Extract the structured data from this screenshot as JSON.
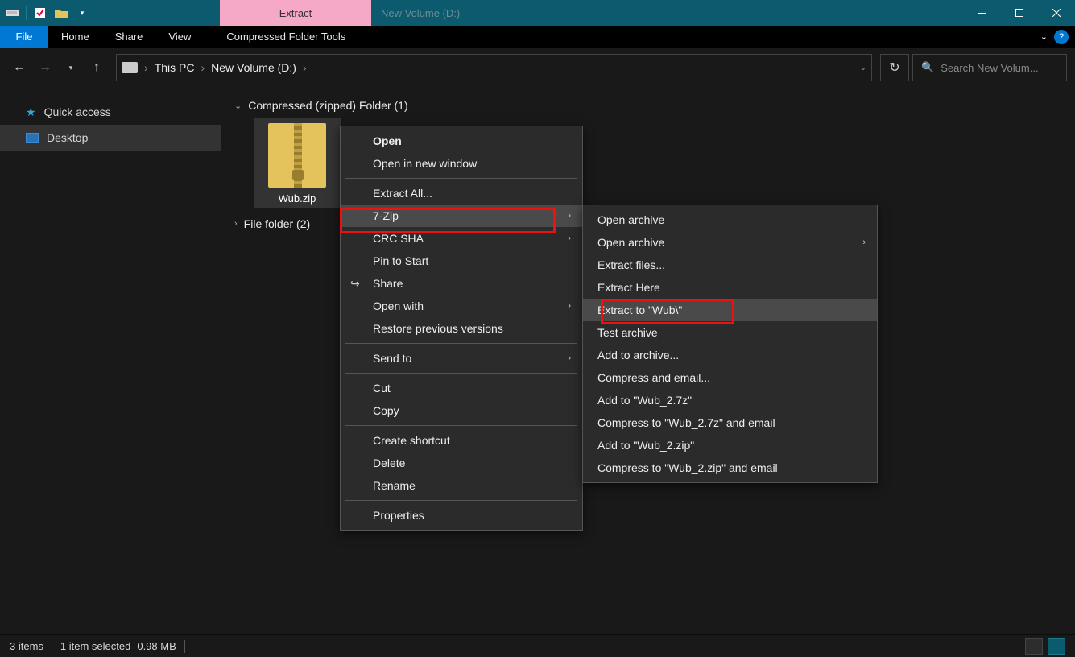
{
  "titlebar": {
    "contextual_tab": "Extract",
    "title": "New Volume (D:)"
  },
  "ribbon": {
    "file": "File",
    "tabs": [
      "Home",
      "Share",
      "View"
    ],
    "contextual": "Compressed Folder Tools"
  },
  "breadcrumb": {
    "root": "This PC",
    "path": "New Volume (D:)"
  },
  "search": {
    "placeholder": "Search New Volum..."
  },
  "sidebar": {
    "quick_access": "Quick access",
    "desktop": "Desktop"
  },
  "groups": {
    "zipped": "Compressed (zipped) Folder (1)",
    "folders": "File folder (2)"
  },
  "file": {
    "name": "Wub.zip"
  },
  "context_menu": {
    "open": "Open",
    "open_new_window": "Open in new window",
    "extract_all": "Extract All...",
    "seven_zip": "7-Zip",
    "crc_sha": "CRC SHA",
    "pin_to_start": "Pin to Start",
    "share": "Share",
    "open_with": "Open with",
    "restore": "Restore previous versions",
    "send_to": "Send to",
    "cut": "Cut",
    "copy": "Copy",
    "create_shortcut": "Create shortcut",
    "delete": "Delete",
    "rename": "Rename",
    "properties": "Properties"
  },
  "submenu": {
    "open_archive1": "Open archive",
    "open_archive2": "Open archive",
    "extract_files": "Extract files...",
    "extract_here": "Extract Here",
    "extract_to": "Extract to \"Wub\\\"",
    "test_archive": "Test archive",
    "add_to_archive": "Add to archive...",
    "compress_email": "Compress and email...",
    "add_7z": "Add to \"Wub_2.7z\"",
    "compress_7z_email": "Compress to \"Wub_2.7z\" and email",
    "add_zip": "Add to \"Wub_2.zip\"",
    "compress_zip_email": "Compress to \"Wub_2.zip\" and email"
  },
  "status": {
    "items": "3 items",
    "selected": "1 item selected",
    "size": "0.98 MB"
  }
}
